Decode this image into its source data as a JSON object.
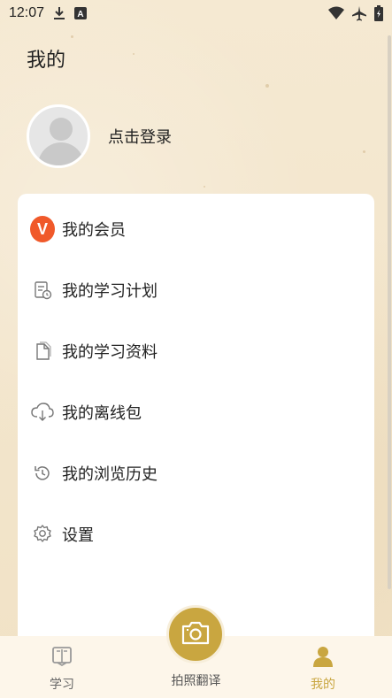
{
  "status_bar": {
    "time": "12:07",
    "icons": [
      "download-icon",
      "keyboard-a-icon",
      "wifi-icon",
      "airplane-icon",
      "battery-icon"
    ]
  },
  "header": {
    "title": "我的"
  },
  "profile": {
    "login_text": "点击登录"
  },
  "menu": {
    "items": [
      {
        "label": "我的会员",
        "icon": "vip-icon"
      },
      {
        "label": "我的学习计划",
        "icon": "plan-icon"
      },
      {
        "label": "我的学习资料",
        "icon": "document-icon"
      },
      {
        "label": "我的离线包",
        "icon": "cloud-download-icon"
      },
      {
        "label": "我的浏览历史",
        "icon": "history-icon"
      },
      {
        "label": "设置",
        "icon": "settings-icon"
      }
    ],
    "vip_badge": "V"
  },
  "bottom_nav": {
    "items": [
      {
        "label": "学习",
        "icon": "book-icon",
        "active": false
      },
      {
        "label": "拍照翻译",
        "icon": "camera-icon",
        "active": false
      },
      {
        "label": "我的",
        "icon": "person-icon",
        "active": true
      }
    ]
  },
  "colors": {
    "accent": "#c9a640",
    "vip": "#f0592a",
    "background": "#f3e6cd"
  }
}
